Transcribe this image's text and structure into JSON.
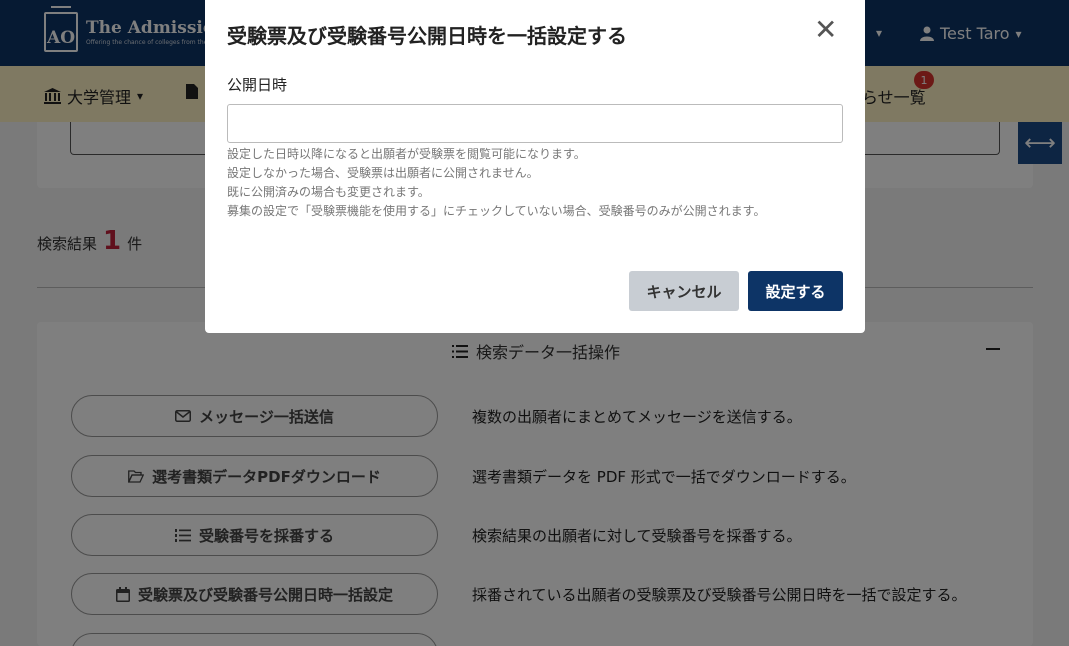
{
  "header": {
    "logo_mark": "AO",
    "logo_title": "The Admission",
    "logo_subtitle": "Offering the chance of colleges from the world",
    "user_name": "Test Taro"
  },
  "nav": {
    "university_mgmt": "大学管理",
    "notices": "らせ一覧",
    "notice_badge": "1"
  },
  "results": {
    "label": "検索結果",
    "count": "1",
    "unit": "件"
  },
  "bulk": {
    "title": "検索データ一括操作",
    "operations": [
      {
        "label": "メッセージ一括送信",
        "desc": "複数の出願者にまとめてメッセージを送信する。"
      },
      {
        "label": "選考書類データPDFダウンロード",
        "desc": "選考書類データを PDF 形式で一括でダウンロードする。"
      },
      {
        "label": "受験番号を採番する",
        "desc": "検索結果の出願者に対して受験番号を採番する。"
      },
      {
        "label": "受験票及び受験番号公開日時一括設定",
        "desc": "採番されている出願者の受験票及び受験番号公開日時を一括で設定する。"
      }
    ]
  },
  "modal": {
    "title": "受験票及び受験番号公開日時を一括設定する",
    "field_label": "公開日時",
    "field_value": "",
    "help": [
      "設定した日時以降になると出願者が受験票を閲覧可能になります。",
      "設定しなかった場合、受験票は出願者に公開されません。",
      "既に公開済みの場合も変更されます。",
      "募集の設定で「受験票機能を使用する」にチェックしていない場合、受験番号のみが公開されます。"
    ],
    "cancel_label": "キャンセル",
    "submit_label": "設定する"
  },
  "icons": {
    "close": "close-icon",
    "user": "user-icon",
    "bank": "bank-icon",
    "file": "file-icon",
    "list": "list-icon",
    "envelope": "envelope-icon",
    "folder": "folder-icon",
    "numbered_list": "numbered-list-icon",
    "calendar": "calendar-icon",
    "resize": "resize-horizontal-icon"
  },
  "colors": {
    "header": "#0d3466",
    "nav": "#fff3c4",
    "accent": "#c0203a",
    "primary_button": "#0d3466"
  }
}
